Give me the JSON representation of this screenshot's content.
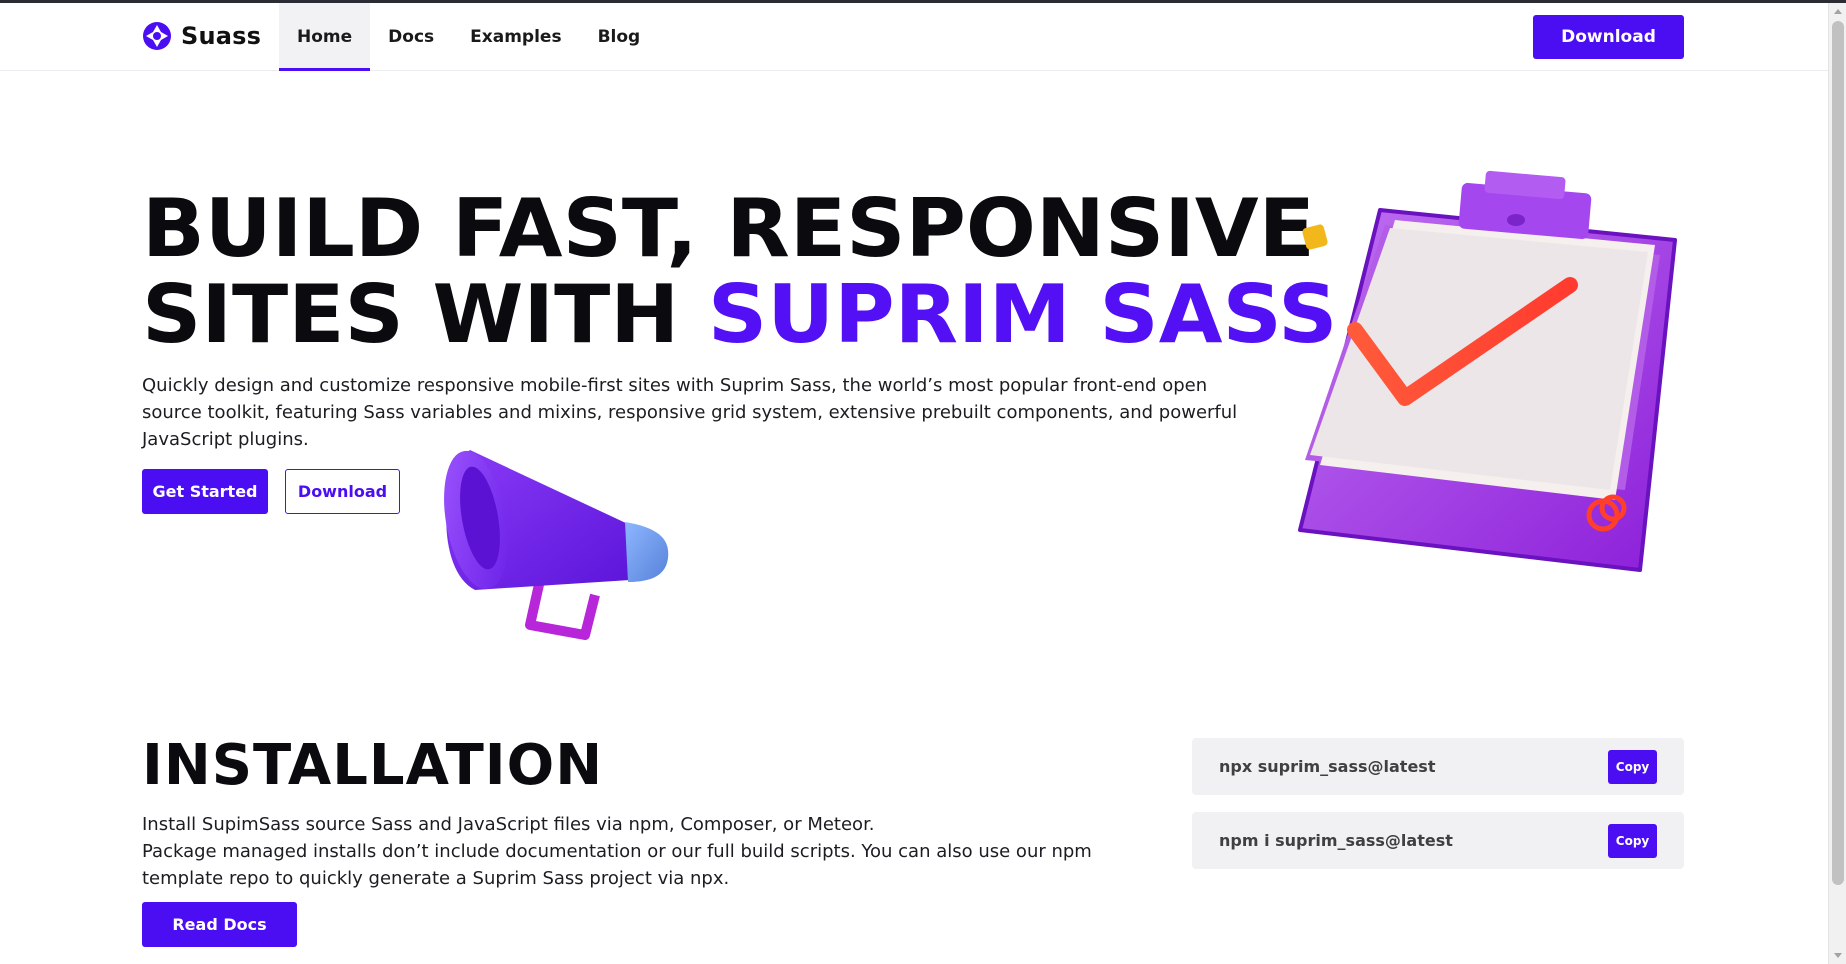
{
  "nav": {
    "brand": "Suass",
    "links": [
      {
        "label": "Home",
        "active": true
      },
      {
        "label": "Docs",
        "active": false
      },
      {
        "label": "Examples",
        "active": false
      },
      {
        "label": "Blog",
        "active": false
      }
    ],
    "download_label": "Download"
  },
  "hero": {
    "title_line1": "BUILD FAST, RESPONSIVE",
    "title_line2_plain": "SITES WITH ",
    "title_line2_accent": "SUPRIM SASS",
    "description": "Quickly design and customize responsive mobile-first sites with Suprim Sass, the world’s most popular front-end open source toolkit, featuring Sass variables and mixins, responsive grid system, extensive prebuilt components, and powerful JavaScript plugins.",
    "get_started_label": "Get Started",
    "download_label": "Download"
  },
  "installation": {
    "title": "INSTALLATION",
    "line1": "Install SupimSass source Sass and JavaScript files via npm, Composer, or Meteor.",
    "line2": "Package managed installs don’t include documentation or our full build scripts. You can also use our npm template repo to quickly generate a Suprim Sass project via npx.",
    "read_docs_label": "Read Docs",
    "commands": [
      {
        "text": "npx suprim_sass@latest",
        "copy_label": "Copy"
      },
      {
        "text": "npm i suprim_sass@latest",
        "copy_label": "Copy"
      }
    ]
  },
  "colors": {
    "accent": "#4b0ef2",
    "title_accent": "#5410f4",
    "text": "#0b0b0f"
  },
  "icons": {
    "brand": "suass-logo-icon",
    "hero_left": "megaphone-illustration",
    "hero_right": "clipboard-checkmark-illustration"
  }
}
